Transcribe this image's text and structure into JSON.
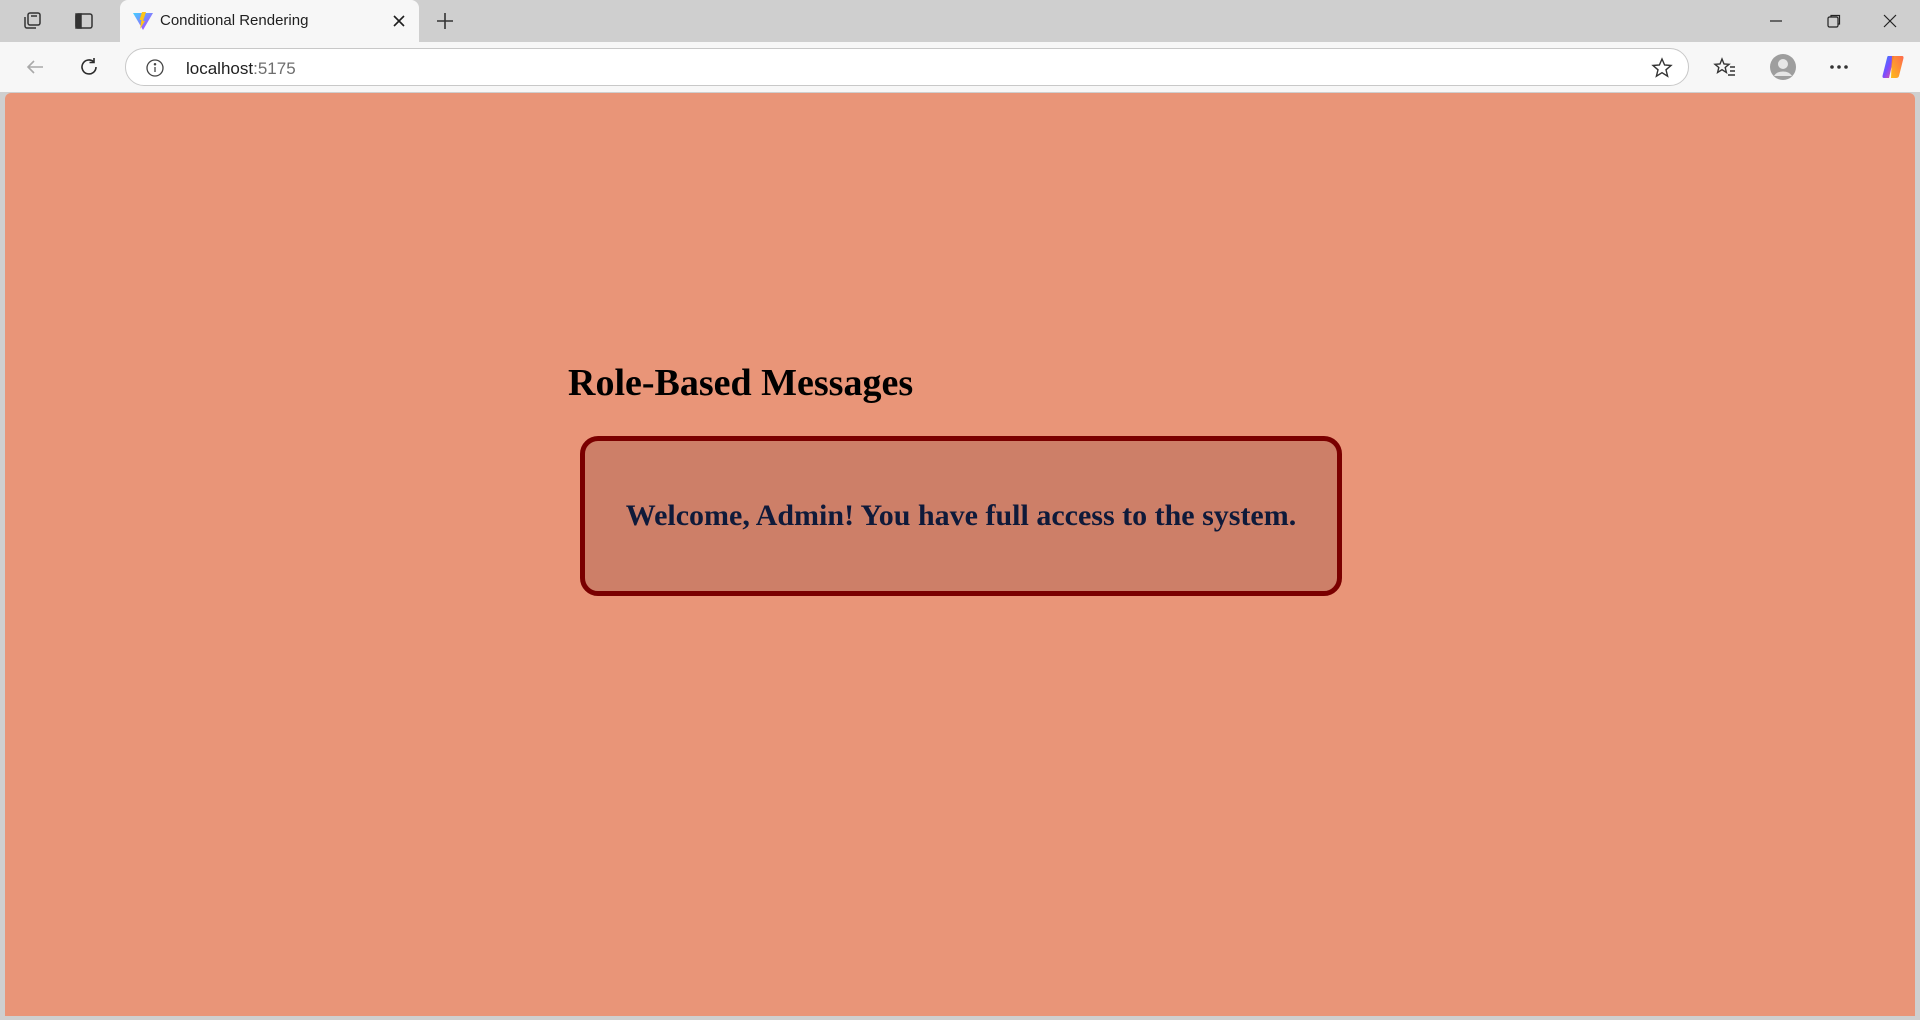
{
  "browser": {
    "tab": {
      "title": "Conditional Rendering",
      "favicon": "vite-logo-icon"
    },
    "address_bar": {
      "host": "localhost",
      "port": ":5175"
    },
    "icons": {
      "workspaces": "workspaces-icon",
      "tab_actions": "tab-actions-icon",
      "close_tab": "close-icon",
      "new_tab": "plus-icon",
      "minimize": "minimize-icon",
      "restore": "restore-icon",
      "close_window": "close-icon",
      "back": "back-arrow-icon",
      "refresh": "refresh-icon",
      "site_info": "info-icon",
      "favorite": "star-icon",
      "favorites": "favorites-list-icon",
      "profile": "profile-avatar-icon",
      "more": "more-icon",
      "copilot": "copilot-icon"
    }
  },
  "page": {
    "heading": "Role-Based Messages",
    "message": "Welcome, Admin! You have full access to the system.",
    "colors": {
      "background": "#e99578",
      "box_fill": "#cd7f68",
      "box_border": "#7a0000",
      "message_text": "#0f1a3a"
    }
  }
}
